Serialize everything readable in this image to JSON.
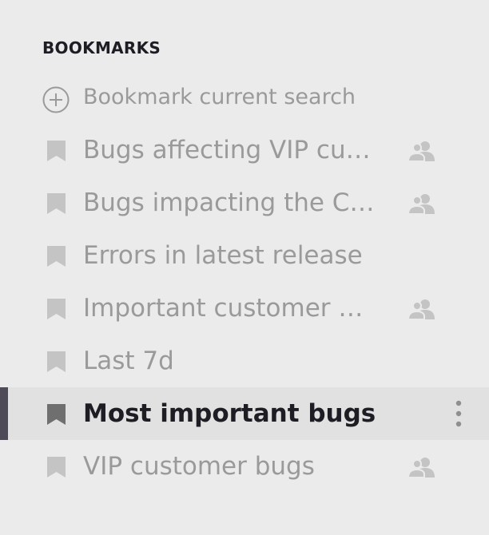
{
  "section": {
    "title": "BOOKMARKS"
  },
  "add_action": {
    "label": "Bookmark current search",
    "icon": "plus-circle-icon"
  },
  "bookmarks": [
    {
      "name": "Bugs affecting VIP customers",
      "display": "Bugs affecting VIP custo…",
      "shared": true,
      "active": false
    },
    {
      "name": "Bugs impacting the CEO",
      "display": "Bugs impacting the CEO",
      "shared": true,
      "active": false
    },
    {
      "name": "Errors in latest release",
      "display": "Errors in latest release",
      "shared": false,
      "active": false
    },
    {
      "name": "Important customer bugs",
      "display": "Important customer bugs",
      "shared": true,
      "active": false
    },
    {
      "name": "Last 7d",
      "display": "Last 7d",
      "shared": false,
      "active": false
    },
    {
      "name": "Most important bugs",
      "display": "Most important bugs",
      "shared": false,
      "active": true
    },
    {
      "name": "VIP customer bugs",
      "display": "VIP customer bugs",
      "shared": true,
      "active": false
    }
  ],
  "colors": {
    "background": "#ebebeb",
    "active_row": "#e1e1e1",
    "indicator": "#4e4a58",
    "muted_text": "#9a9a9a",
    "strong_text": "#1f1d24",
    "icon": "#c4c4c4"
  }
}
